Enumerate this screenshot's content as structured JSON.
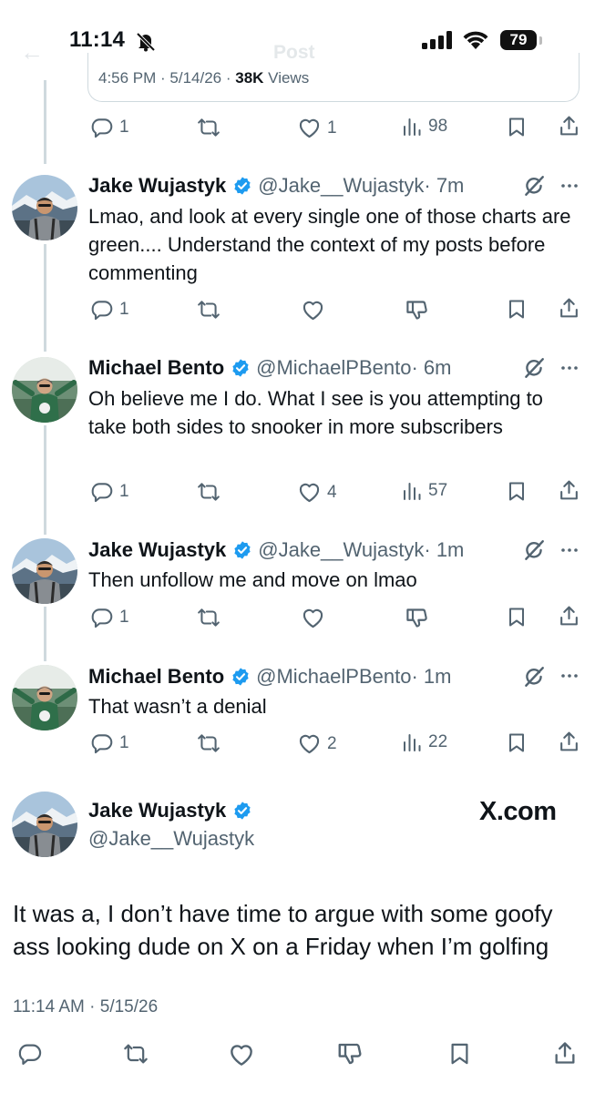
{
  "status_bar": {
    "time": "11:14",
    "battery": "79"
  },
  "header": {
    "title": "Post"
  },
  "quoted_card": {
    "time": "4:56 PM · 5/14/26 · ",
    "views": "38K",
    "views_label": " Views"
  },
  "top_actions": {
    "replies": "1",
    "likes": "1",
    "views": "98"
  },
  "replies": [
    {
      "name": "Jake Wujastyk",
      "handle": "@Jake__Wujastyk",
      "time": "· 7m",
      "text": "Lmao, and look at every single one of those charts are green.... Understand the context of my posts before commenting",
      "replies": "1",
      "likes": "",
      "views": ""
    },
    {
      "name": "Michael Bento",
      "handle": "@MichaelPBento",
      "time": "· 6m",
      "text": "Oh believe me I do. What I see is you attempting to take both sides to snooker in more subscribers",
      "replies": "1",
      "likes": "4",
      "views": "57"
    },
    {
      "name": "Jake Wujastyk",
      "handle": "@Jake__Wujastyk",
      "time": "· 1m",
      "text": "Then unfollow me and move on lmao",
      "replies": "1",
      "likes": "",
      "views": ""
    },
    {
      "name": "Michael Bento",
      "handle": "@MichaelPBento",
      "time": "· 1m",
      "text": "That wasn’t a denial",
      "replies": "1",
      "likes": "2",
      "views": "22"
    }
  ],
  "main_tweet": {
    "name": "Jake Wujastyk",
    "handle": "@Jake__Wujastyk",
    "watermark": "X.com",
    "text": "It was a, I don’t have time to argue with some goofy ass looking dude on X on a Friday when I’m golfing",
    "timestamp": "11:14 AM · 5/15/26"
  },
  "colors": {
    "verified": "#1d9bf0",
    "secondary_text": "#536471",
    "divider": "#cfd9de"
  }
}
